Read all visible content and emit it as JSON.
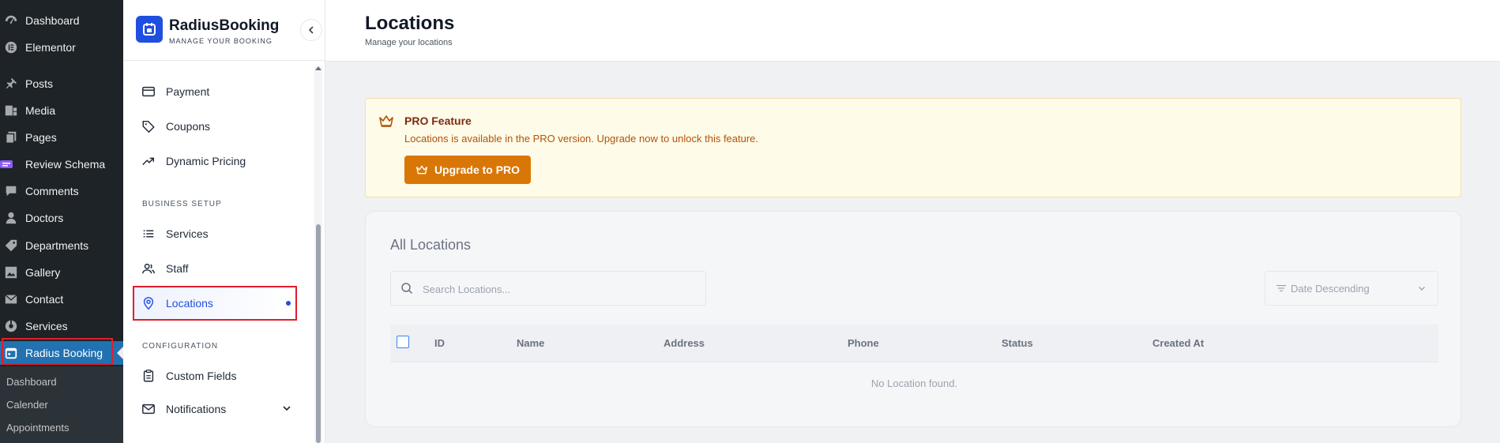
{
  "wp_menu": {
    "items": [
      {
        "key": "dashboard",
        "label": "Dashboard",
        "icon": "gauge-icon"
      },
      {
        "key": "elementor",
        "label": "Elementor",
        "icon": "elementor-icon"
      },
      {
        "key": "posts",
        "label": "Posts",
        "icon": "pin-icon"
      },
      {
        "key": "media",
        "label": "Media",
        "icon": "media-icon"
      },
      {
        "key": "pages",
        "label": "Pages",
        "icon": "pages-icon"
      },
      {
        "key": "review-schema",
        "label": "Review Schema",
        "icon": "review-icon"
      },
      {
        "key": "comments",
        "label": "Comments",
        "icon": "comment-icon"
      },
      {
        "key": "doctors",
        "label": "Doctors",
        "icon": "user-icon"
      },
      {
        "key": "departments",
        "label": "Departments",
        "icon": "tag-icon"
      },
      {
        "key": "gallery",
        "label": "Gallery",
        "icon": "gallery-icon"
      },
      {
        "key": "contact",
        "label": "Contact",
        "icon": "mail-icon"
      },
      {
        "key": "services",
        "label": "Services",
        "icon": "services-icon"
      },
      {
        "key": "radius-booking",
        "label": "Radius Booking",
        "icon": "calendar-icon"
      }
    ],
    "sub_items": [
      "Dashboard",
      "Calender",
      "Appointments"
    ]
  },
  "plugin": {
    "brand": "RadiusBooking",
    "tagline": "MANAGE YOUR BOOKING",
    "nav": {
      "payment": "Payment",
      "coupons": "Coupons",
      "dynamic_pricing": "Dynamic Pricing",
      "section_business": "BUSINESS SETUP",
      "services": "Services",
      "staff": "Staff",
      "locations": "Locations",
      "section_config": "CONFIGURATION",
      "custom_fields": "Custom Fields",
      "notifications": "Notifications"
    }
  },
  "header": {
    "title": "Locations",
    "subtitle": "Manage your locations"
  },
  "pro": {
    "title": "PRO Feature",
    "description": "Locations is available in the PRO version. Upgrade now to unlock this feature.",
    "button": "Upgrade to PRO"
  },
  "list": {
    "title": "All Locations",
    "search_placeholder": "Search Locations...",
    "sort_label": "Date Descending",
    "columns": [
      "ID",
      "Name",
      "Address",
      "Phone",
      "Status",
      "Created At"
    ],
    "empty_text": "No Location found."
  },
  "colors": {
    "wp_active": "#2271b1",
    "plugin_accent": "#1f4fe0",
    "pro_button": "#d97706"
  }
}
